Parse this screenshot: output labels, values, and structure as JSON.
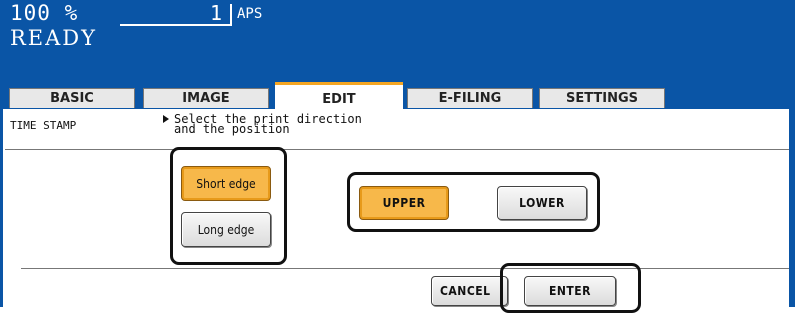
{
  "status_bar": {
    "zoom": "100  %",
    "copies": "1",
    "paper_mode": "APS",
    "status": "READY"
  },
  "tabs": [
    {
      "label": "BASIC",
      "active": false
    },
    {
      "label": "IMAGE",
      "active": false
    },
    {
      "label": "EDIT",
      "active": true
    },
    {
      "label": "E-FILING",
      "active": false
    },
    {
      "label": "SETTINGS",
      "active": false
    }
  ],
  "screen": {
    "function_label": "TIME STAMP",
    "instruction_line1": "Select the print direction",
    "instruction_line2": "and the position"
  },
  "direction": {
    "short_edge": "Short edge",
    "long_edge": "Long edge",
    "selected": "Short edge"
  },
  "position": {
    "upper": "UPPER",
    "lower": "LOWER",
    "selected": "UPPER"
  },
  "actions": {
    "cancel": "CANCEL",
    "enter": "ENTER"
  },
  "colors": {
    "header_blue": "#0a55a6",
    "selected_orange": "#f7b84a",
    "active_tab_accent": "#f5a623"
  }
}
